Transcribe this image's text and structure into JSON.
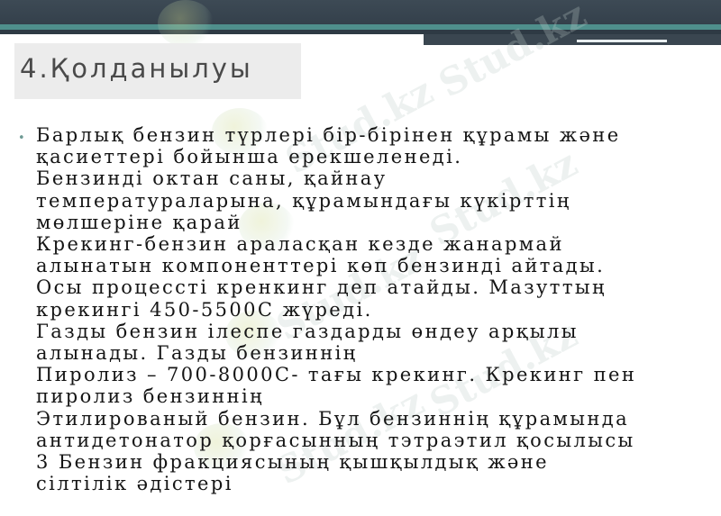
{
  "watermark": {
    "text": "Stud.kz",
    "text_full": "Stud.kz - Stud.kz"
  },
  "slide": {
    "title": "4.Қолданылуы",
    "bullet_lines": [
      "Барлық бензин түрлері бір-бірінен құрамы және",
      "қасиеттері бойынша ерекшеленеді.",
      "Бензинді октан саны, қайнау",
      "температураларына, құрамындағы күкірттің",
      "мөлшеріне қарай",
      "Крекинг-бензин араласқан кезде жанармай",
      "алынатын компоненттері көп бензинді айтады.",
      "Осы процессті кренкинг деп атайды. Мазуттың",
      "крекингі 450-5500С жүреді.",
      "Газды бензин ілеспе газдарды өндеу арқылы",
      "алынады. Газды бензиннің",
      "Пиролиз – 700-8000С- тағы крекинг. Крекинг пен",
      "пиролиз бензиннің",
      "Этилированый бензин. Бұл бензиннің құрамында",
      "антидетонатор қорғасынның тэтраэтил қосылысы",
      "3 Бензин фракциясының қышқылдық және",
      "сілтілік әдістері"
    ]
  },
  "colors": {
    "header_dark": "#34404b",
    "header_teal": "#4f8f8c",
    "title_box": "#ececec",
    "title_text": "#4a4a4a",
    "bullet": "#6e9a94",
    "body_text": "#151515"
  }
}
